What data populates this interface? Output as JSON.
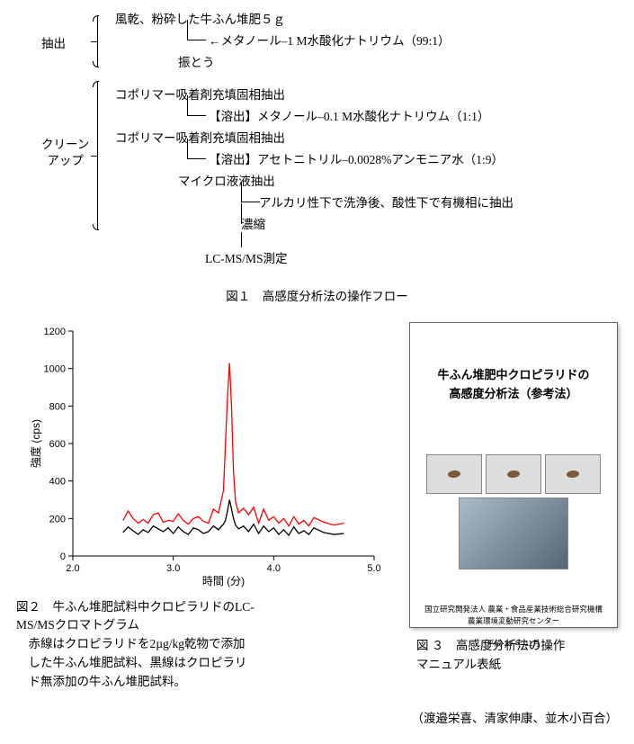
{
  "flow": {
    "bracket1_label": "抽出",
    "bracket2_label": "クリーン\nアップ",
    "step1": "風乾、粉砕した牛ふん堆肥５ｇ",
    "step1_arrow": "←メタノール–1 M水酸化ナトリウム（99:1）",
    "step2": "振とう",
    "step3": "コポリマー吸着剤充填固相抽出",
    "step3_note": "【溶出】メタノール–0.1 M水酸化ナトリウム（1:1）",
    "step4": "コポリマー吸着剤充填固相抽出",
    "step4_note": "【溶出】アセトニトリル–0.0028%アンモニア水（1:9）",
    "step5": "マイクロ液液抽出",
    "step5_note": "アルカリ性下で洗浄後、酸性下で有機相に抽出",
    "step6": "濃縮",
    "step7": "LC-MS/MS測定",
    "caption": "図１　高感度分析法の操作フロー"
  },
  "chart_data": {
    "type": "line",
    "title": "",
    "xlabel": "時間 (分)",
    "ylabel": "強度 (cps)",
    "xlim": [
      2.0,
      5.0
    ],
    "ylim": [
      0,
      1200
    ],
    "x_ticks": [
      2.0,
      3.0,
      4.0,
      5.0
    ],
    "y_ticks": [
      0,
      200,
      400,
      600,
      800,
      1000,
      1200
    ],
    "x": [
      2.5,
      2.55,
      2.6,
      2.65,
      2.7,
      2.75,
      2.8,
      2.85,
      2.9,
      2.95,
      3.0,
      3.05,
      3.1,
      3.15,
      3.2,
      3.25,
      3.3,
      3.35,
      3.4,
      3.45,
      3.5,
      3.52,
      3.54,
      3.56,
      3.58,
      3.6,
      3.62,
      3.65,
      3.7,
      3.75,
      3.8,
      3.85,
      3.9,
      3.95,
      4.0,
      4.05,
      4.1,
      4.15,
      4.2,
      4.25,
      4.3,
      4.35,
      4.4,
      4.5,
      4.6,
      4.7
    ],
    "series": [
      {
        "name": "red",
        "values": [
          190,
          240,
          200,
          175,
          195,
          175,
          220,
          230,
          180,
          190,
          185,
          225,
          190,
          170,
          200,
          210,
          185,
          175,
          250,
          230,
          350,
          600,
          850,
          1030,
          800,
          450,
          290,
          230,
          255,
          220,
          260,
          175,
          250,
          190,
          210,
          175,
          200,
          160,
          210,
          170,
          190,
          160,
          205,
          180,
          165,
          175
        ]
      },
      {
        "name": "black",
        "values": [
          125,
          155,
          135,
          115,
          140,
          125,
          160,
          145,
          130,
          150,
          120,
          155,
          130,
          115,
          150,
          140,
          120,
          130,
          160,
          140,
          170,
          190,
          240,
          300,
          250,
          200,
          165,
          145,
          160,
          130,
          170,
          120,
          160,
          130,
          150,
          115,
          140,
          110,
          155,
          120,
          135,
          115,
          150,
          125,
          115,
          120
        ]
      }
    ]
  },
  "fig2_caption": {
    "line1": "図２　牛ふん堆肥試料中クロピラリドのLC-",
    "line2": "MS/MSクロマトグラム",
    "line3": "　赤線はクロピラリドを2µg/kg乾物で添加",
    "line4": "　した牛ふん堆肥試料、黒線はクロピラリ",
    "line5": "　ド無添加の牛ふん堆肥試料。"
  },
  "fig3_doc": {
    "title1": "牛ふん堆肥中クロピラリドの",
    "title2": "高感度分析法（参考法）",
    "date": "平成 29 年 11月",
    "org1": "国立研究開発法人 農業・食品産業技術総合研究機構",
    "org2": "農業環境変動研究センター"
  },
  "fig3_caption": {
    "line1": "図 ３　高感度分析法の操作",
    "line2": "マニュアル表紙"
  },
  "authors": "（渡邉栄喜、清家伸康、並木小百合）"
}
